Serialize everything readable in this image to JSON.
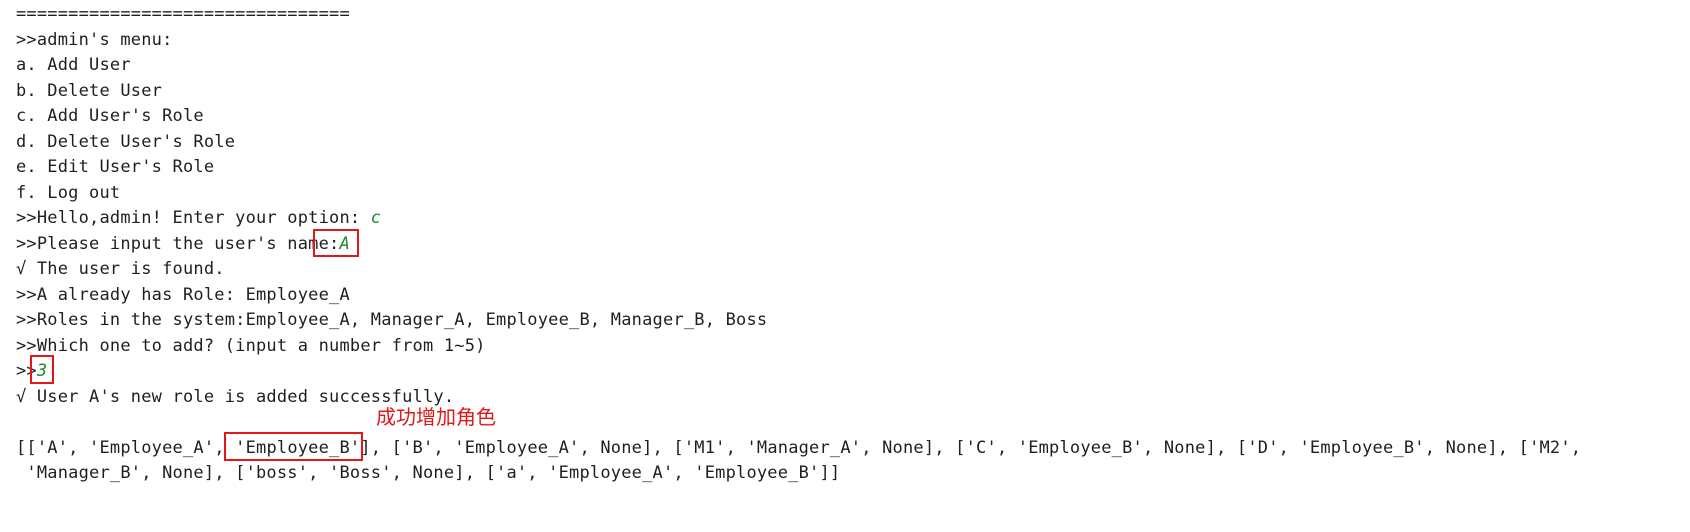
{
  "console": {
    "separator": "================================",
    "menu_title": ">>admin's menu:",
    "menu_items": [
      "a. Add User",
      "b. Delete User",
      "c. Add User's Role",
      "d. Delete User's Role",
      "e. Edit User's Role",
      "f. Log out"
    ],
    "option_prompt": ">>Hello,admin! Enter your option: ",
    "option_input": "c",
    "name_prompt": ">>Please input the user's name:",
    "name_input": "A",
    "found_msg": "√ The user is found.",
    "has_role_msg": ">>A already has Role: Employee_A",
    "roles_msg": ">>Roles in the system:Employee_A, Manager_A, Employee_B, Manager_B, Boss",
    "which_msg": ">>Which one to add? (input a number from 1~5)",
    "number_prompt": ">>",
    "number_input": "3",
    "success_msg": "√ User A's new role is added successfully.",
    "data_line_1a": "[['A', 'Employee_A', ",
    "data_line_1b": "'Employee_B'",
    "data_line_1c": "], ['B', 'Employee_A', None], ['M1', 'Manager_A', None], ['C', 'Employee_B', None], ['D', 'Employee_B', None], ['M2',",
    "data_line_2": " 'Manager_B', None], ['boss', 'Boss', None], ['a', 'Employee_A', 'Employee_B']]"
  },
  "annotation": {
    "text": "成功增加角色",
    "color": "#e01818"
  },
  "colors": {
    "input_text": "#1a8a2e",
    "highlight_box": "#e01818",
    "text": "#1f1f1f"
  }
}
